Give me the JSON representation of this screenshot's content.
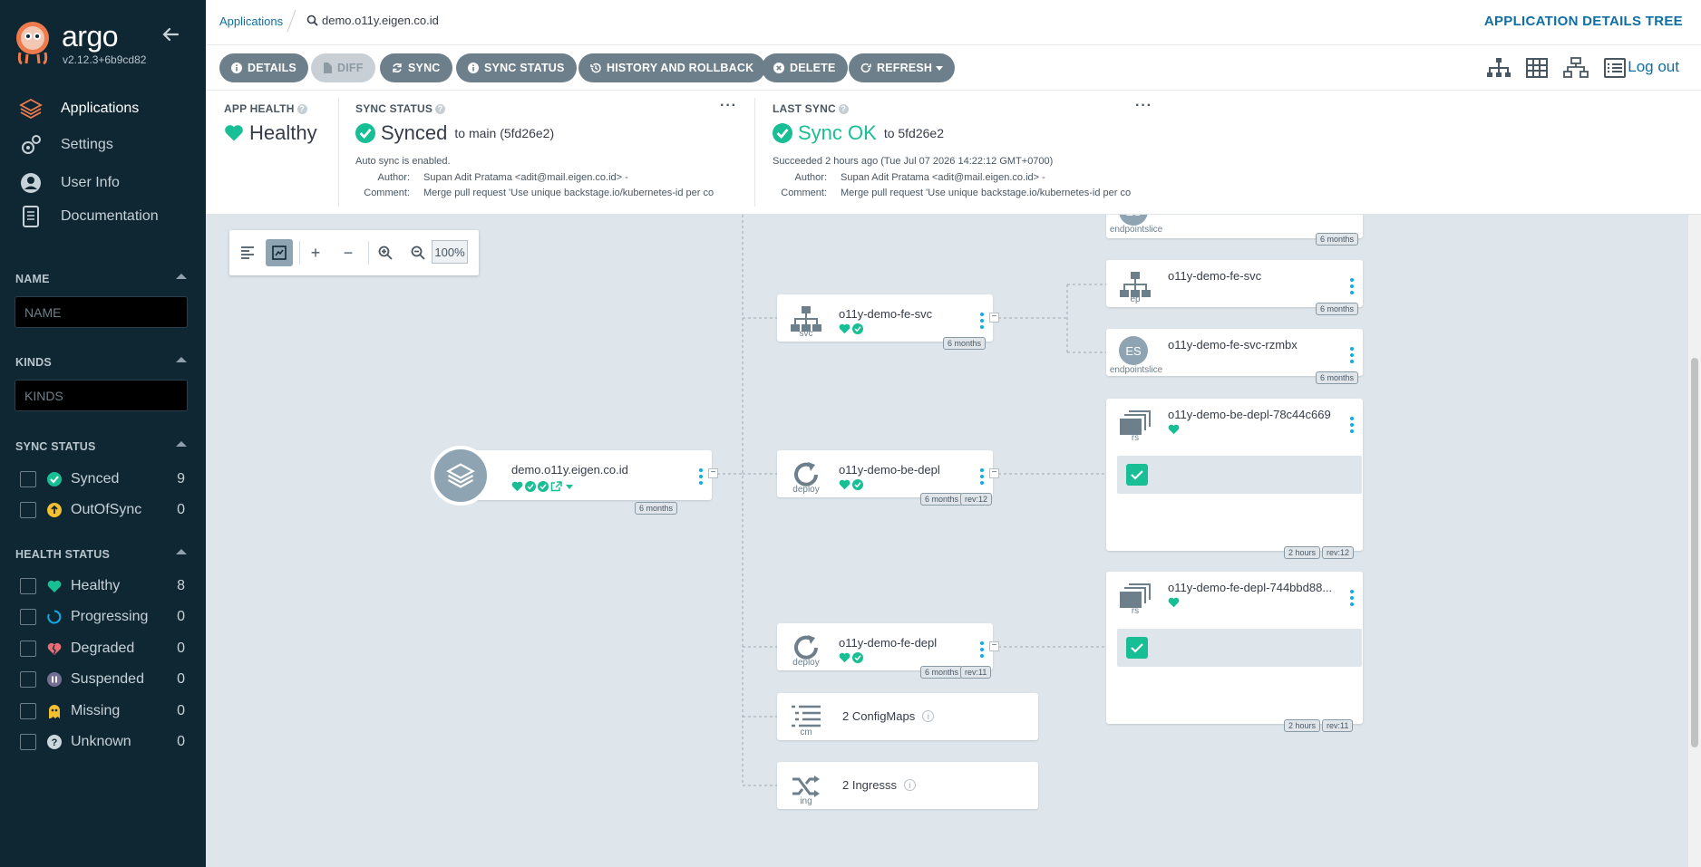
{
  "app": {
    "brand": "argo",
    "version": "v2.12.3+6b9cd82"
  },
  "nav": [
    {
      "label": "Applications",
      "icon": "layers-icon",
      "active": true
    },
    {
      "label": "Settings",
      "icon": "gears-icon"
    },
    {
      "label": "User Info",
      "icon": "user-circle-icon"
    },
    {
      "label": "Documentation",
      "icon": "book-icon"
    }
  ],
  "filters": {
    "name": {
      "title": "NAME",
      "placeholder": "NAME"
    },
    "kinds": {
      "title": "KINDS",
      "placeholder": "KINDS"
    },
    "sync_status": {
      "title": "SYNC STATUS",
      "items": [
        {
          "label": "Synced",
          "count": "9",
          "color": "#18be94"
        },
        {
          "label": "OutOfSync",
          "count": "0",
          "color": "#f4c030"
        }
      ]
    },
    "health_status": {
      "title": "HEALTH STATUS",
      "items": [
        {
          "label": "Healthy",
          "count": "8",
          "color": "#18be94"
        },
        {
          "label": "Progressing",
          "count": "0",
          "color": "#0dadea"
        },
        {
          "label": "Degraded",
          "count": "0",
          "color": "#e96d76"
        },
        {
          "label": "Suspended",
          "count": "0",
          "color": "#766f94"
        },
        {
          "label": "Missing",
          "count": "0",
          "color": "#f4c030"
        },
        {
          "label": "Unknown",
          "count": "0",
          "color": "#ccd6dd"
        }
      ]
    }
  },
  "breadcrumb": {
    "root": "Applications",
    "current": "demo.o11y.eigen.co.id"
  },
  "page_title": "APPLICATION DETAILS TREE",
  "toolbar": {
    "details": "DETAILS",
    "diff": "DIFF",
    "sync": "SYNC",
    "sync_status": "SYNC STATUS",
    "history": "HISTORY AND ROLLBACK",
    "delete": "DELETE",
    "refresh": "REFRESH",
    "logout": "Log out"
  },
  "status": {
    "app_health": {
      "label": "APP HEALTH",
      "value": "Healthy"
    },
    "sync_status": {
      "label": "SYNC STATUS",
      "value": "Synced",
      "target": "to main (5fd26e2)",
      "auto": "Auto sync is enabled.",
      "author_k": "Author:",
      "author_v": "Supan Adit Pratama <adit@mail.eigen.co.id> -",
      "comment_k": "Comment:",
      "comment_v": "Merge pull request 'Use unique backstage.io/kubernetes-id per co"
    },
    "last_sync": {
      "label": "LAST SYNC",
      "value": "Sync OK",
      "target": "to 5fd26e2",
      "when": "Succeeded 2 hours ago (Tue Jul 07 2026 14:22:12 GMT+0700)",
      "author_k": "Author:",
      "author_v": "Supan Adit Pratama <adit@mail.eigen.co.id> -",
      "comment_k": "Comment:",
      "comment_v": "Merge pull request 'Use unique backstage.io/kubernetes-id per co"
    }
  },
  "graph": {
    "zoom": "100%",
    "root": {
      "name": "demo.o11y.eigen.co.id",
      "age": "6 months"
    },
    "nodes": {
      "es_top": {
        "kind": "endpointslice",
        "age": "6 months",
        "badge": "ES"
      },
      "fe_svc": {
        "name": "o11y-demo-fe-svc",
        "kind": "svc",
        "age": "6 months"
      },
      "ep": {
        "name": "o11y-demo-fe-svc",
        "kind": "ep",
        "age": "6 months"
      },
      "es": {
        "name": "o11y-demo-fe-svc-rzmbx",
        "kind": "endpointslice",
        "age": "6 months",
        "badge": "ES"
      },
      "be_depl": {
        "name": "o11y-demo-be-depl",
        "kind": "deploy",
        "age": "6 months",
        "rev": "rev:12"
      },
      "be_rs": {
        "name": "o11y-demo-be-depl-78c44c669",
        "kind": "rs",
        "age": "2 hours",
        "rev": "rev:12"
      },
      "fe_depl": {
        "name": "o11y-demo-fe-depl",
        "kind": "deploy",
        "age": "6 months",
        "rev": "rev:11"
      },
      "fe_rs": {
        "name": "o11y-demo-fe-depl-744bbd88...",
        "kind": "rs",
        "age": "2 hours",
        "rev": "rev:11"
      },
      "cm": {
        "name": "2 ConfigMaps",
        "kind": "cm"
      },
      "ing": {
        "name": "2 Ingresss",
        "kind": "ing"
      }
    }
  },
  "colors": {
    "healthy": "#18be94",
    "accent": "#0f6fa3",
    "sidebar": "#0f2733"
  }
}
